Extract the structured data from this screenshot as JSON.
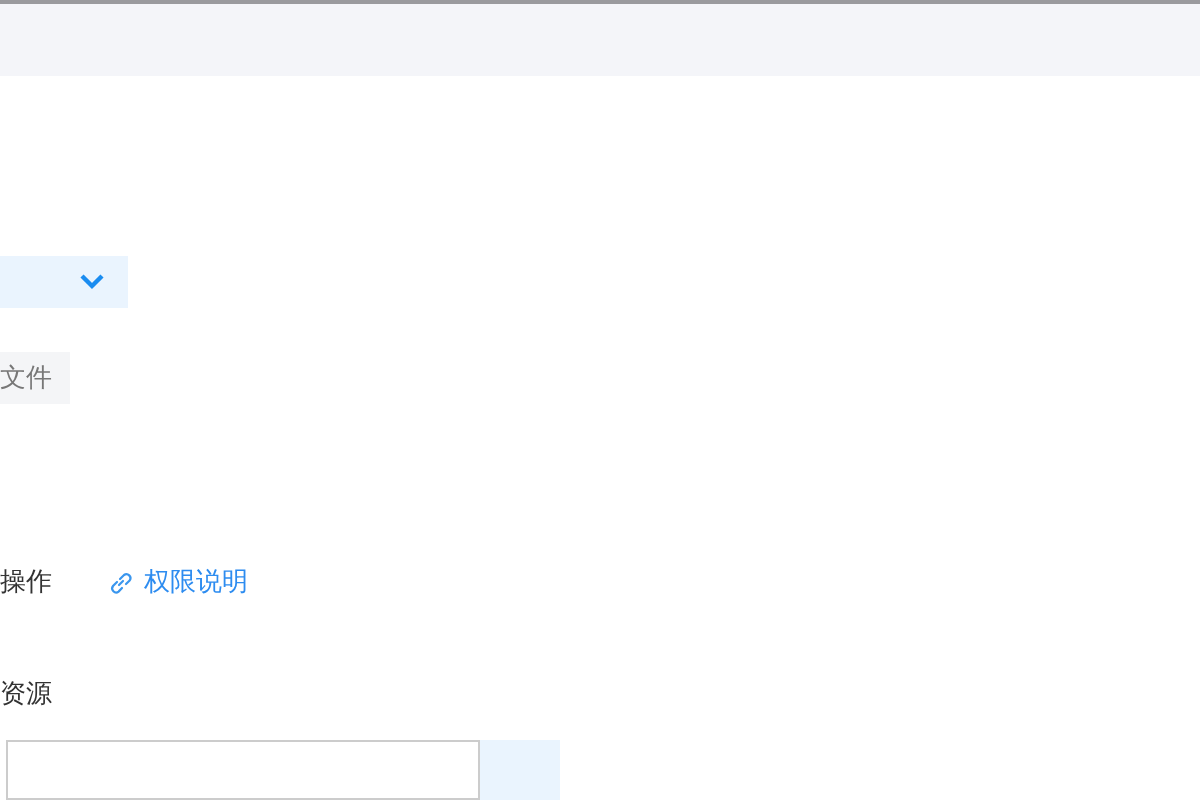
{
  "select": {
    "expanded": false
  },
  "file_button": {
    "label": "文件"
  },
  "operation": {
    "label": "操作",
    "link": "权限说明"
  },
  "resource": {
    "label": "资源"
  }
}
